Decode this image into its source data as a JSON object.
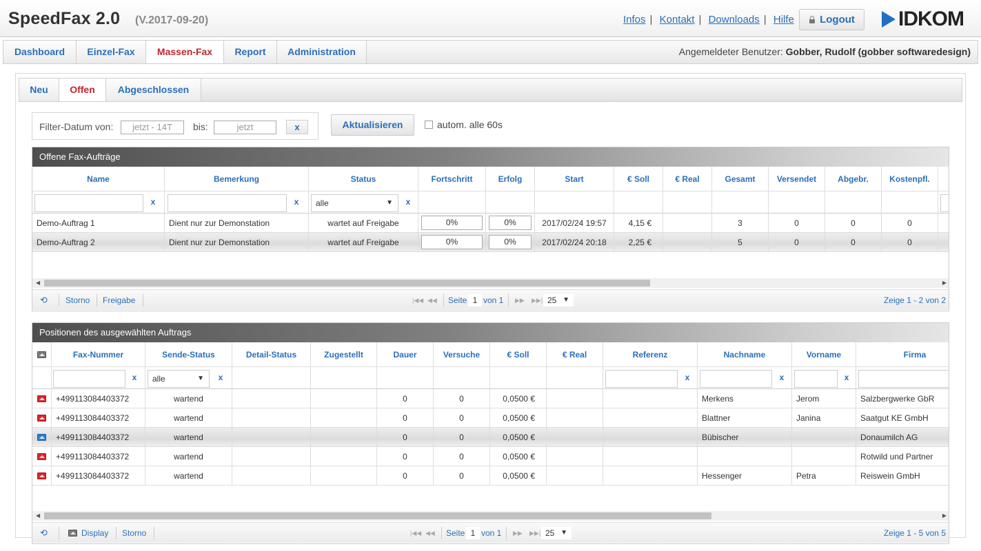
{
  "app": {
    "title": "SpeedFax 2.0",
    "version": "(V.2017-09-20)",
    "logo_text": "IDKOM",
    "brand_color": "#1f6fc6"
  },
  "toplinks": [
    "Infos",
    "Kontakt",
    "Downloads",
    "Hilfe"
  ],
  "logout_label": "Logout",
  "nav": {
    "tabs": [
      "Dashboard",
      "Einzel-Fax",
      "Massen-Fax",
      "Report",
      "Administration"
    ],
    "active": "Massen-Fax",
    "user_label": "Angemeldeter Benutzer:",
    "user_name": "Gobber, Rudolf (gobber softwaredesign)"
  },
  "subnav": {
    "tabs": [
      "Neu",
      "Offen",
      "Abgeschlossen"
    ],
    "active": "Offen"
  },
  "filter": {
    "label_from": "Filter-Datum von:",
    "from_placeholder": "jetzt - 14T",
    "label_to": "bis:",
    "to_placeholder": "jetzt",
    "clear": "x",
    "refresh": "Aktualisieren",
    "auto_label": "autom. alle 60s",
    "auto_checked": false
  },
  "orders": {
    "title": "Offene Fax-Aufträge",
    "columns": [
      "Name",
      "Bemerkung",
      "Status",
      "Fortschritt",
      "Erfolg",
      "Start",
      "€ Soll",
      "€ Real",
      "Gesamt",
      "Versendet",
      "Abgebr.",
      "Kostenpfl."
    ],
    "status_filter": "alle",
    "rows": [
      {
        "name": "Demo-Auftrag 1",
        "bemerkung": "Dient nur zur Demonstation",
        "status": "wartet auf Freigabe",
        "fortschritt": "0%",
        "erfolg": "0%",
        "start": "2017/02/24 19:57",
        "soll": "4,15 €",
        "real": "",
        "gesamt": "3",
        "versendet": "0",
        "abgebr": "0",
        "kostenpfl": "0"
      },
      {
        "name": "Demo-Auftrag 2",
        "bemerkung": "Dient nur zur Demonstation",
        "status": "wartet auf Freigabe",
        "fortschritt": "0%",
        "erfolg": "0%",
        "start": "2017/02/24 20:18",
        "soll": "2,25 €",
        "real": "",
        "gesamt": "5",
        "versendet": "0",
        "abgebr": "0",
        "kostenpfl": "0"
      }
    ],
    "pager": {
      "actions": [
        "Storno",
        "Freigabe"
      ],
      "page_label": "Seite",
      "page": "1",
      "of_label": "von 1",
      "page_size": "25",
      "summary": "Zeige 1 - 2 von 2"
    }
  },
  "positions": {
    "title": "Positionen des ausgewählten Auftrags",
    "columns": [
      "Fax-Nummer",
      "Sende-Status",
      "Detail-Status",
      "Zugestellt",
      "Dauer",
      "Versuche",
      "€ Soll",
      "€ Real",
      "Referenz",
      "Nachname",
      "Vorname",
      "Firma"
    ],
    "status_filter": "alle",
    "rows": [
      {
        "icon": "red",
        "nummer": "+499113084403372",
        "status": "wartend",
        "detail": "",
        "zugestellt": "",
        "dauer": "0",
        "versuche": "0",
        "soll": "0,0500 €",
        "real": "",
        "referenz": "",
        "nachname": "Merkens",
        "vorname": "Jerom",
        "firma": "Salzbergwerke GbR"
      },
      {
        "icon": "red",
        "nummer": "+499113084403372",
        "status": "wartend",
        "detail": "",
        "zugestellt": "",
        "dauer": "0",
        "versuche": "0",
        "soll": "0,0500 €",
        "real": "",
        "referenz": "",
        "nachname": "Blattner",
        "vorname": "Janina",
        "firma": "Saatgut KE GmbH"
      },
      {
        "icon": "blue",
        "nummer": "+499113084403372",
        "status": "wartend",
        "detail": "",
        "zugestellt": "",
        "dauer": "0",
        "versuche": "0",
        "soll": "0,0500 €",
        "real": "",
        "referenz": "",
        "nachname": "Bübischer",
        "vorname": "",
        "firma": "Donaumilch AG"
      },
      {
        "icon": "red",
        "nummer": "+499113084403372",
        "status": "wartend",
        "detail": "",
        "zugestellt": "",
        "dauer": "0",
        "versuche": "0",
        "soll": "0,0500 €",
        "real": "",
        "referenz": "",
        "nachname": "",
        "vorname": "",
        "firma": "Rotwild und Partner"
      },
      {
        "icon": "red",
        "nummer": "+499113084403372",
        "status": "wartend",
        "detail": "",
        "zugestellt": "",
        "dauer": "0",
        "versuche": "0",
        "soll": "0,0500 €",
        "real": "",
        "referenz": "",
        "nachname": "Hessenger",
        "vorname": "Petra",
        "firma": "Reiswein GmbH"
      }
    ],
    "pager": {
      "actions": [
        "Display",
        "Storno"
      ],
      "page_label": "Seite",
      "page": "1",
      "of_label": "von 1",
      "page_size": "25",
      "summary": "Zeige 1 - 5 von 5"
    }
  }
}
